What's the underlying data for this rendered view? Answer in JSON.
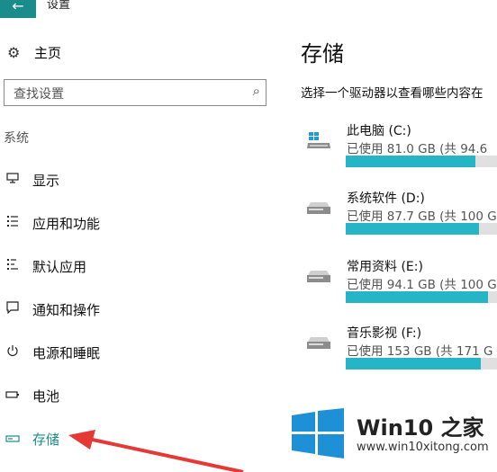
{
  "window": {
    "title": "设置",
    "back_icon": "arrow-left-icon"
  },
  "nav": {
    "home": {
      "label": "主页",
      "icon": "gear-icon"
    },
    "search": {
      "placeholder": "查找设置",
      "icon": "search-icon"
    },
    "section_label": "系统",
    "items": [
      {
        "label": "显示",
        "icon": "monitor-icon",
        "active": false
      },
      {
        "label": "应用和功能",
        "icon": "app-list-icon",
        "active": false
      },
      {
        "label": "默认应用",
        "icon": "default-apps-icon",
        "active": false
      },
      {
        "label": "通知和操作",
        "icon": "message-icon",
        "active": false
      },
      {
        "label": "电源和睡眠",
        "icon": "power-icon",
        "active": false
      },
      {
        "label": "电池",
        "icon": "battery-icon",
        "active": false
      },
      {
        "label": "存储",
        "icon": "storage-icon",
        "active": true
      }
    ]
  },
  "main": {
    "title": "存储",
    "description": "选择一个驱动器以查看哪些内容在",
    "drives": [
      {
        "name": "此电脑 (C:)",
        "usage": "已使用 81.0 GB (共 94.6",
        "used_fraction": 0.86,
        "icon": "windows-drive-icon"
      },
      {
        "name": "系统软件 (D:)",
        "usage": "已使用 87.7 GB (共 100 G",
        "used_fraction": 0.88,
        "icon": "hard-drive-icon"
      },
      {
        "name": "常用资料 (E:)",
        "usage": "已使用 94.1 GB (共 100 G",
        "used_fraction": 0.94,
        "icon": "hard-drive-icon"
      },
      {
        "name": "音乐影视 (F:)",
        "usage": "已使用 153 GB (共 171 G",
        "used_fraction": 0.89,
        "icon": "hard-drive-icon"
      }
    ]
  },
  "watermark": {
    "brand": "Win10 之家",
    "site": "www.win10xitong.com"
  },
  "colors": {
    "accent": "#1a8c8c",
    "bar_fill": "#26b5c7",
    "annotation_arrow": "#e53935"
  }
}
